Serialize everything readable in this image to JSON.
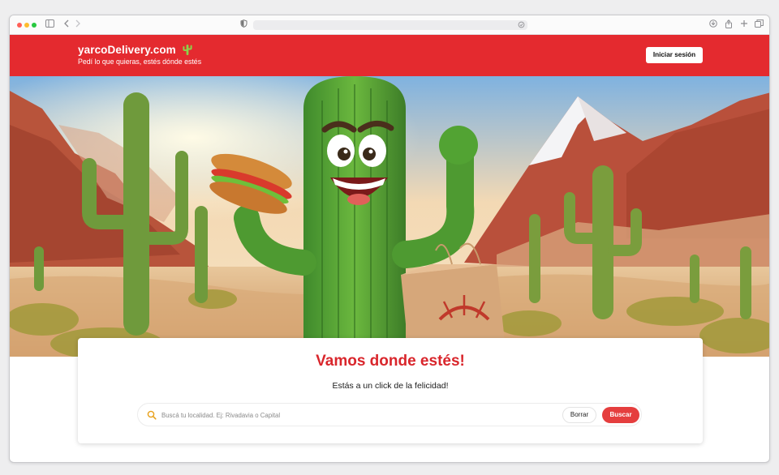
{
  "browser": {
    "icons": {
      "traffic_lights": [
        "close",
        "minimize",
        "zoom"
      ],
      "left": [
        "sidebar-icon",
        "back-icon",
        "forward-icon"
      ],
      "address": [
        "shield-icon",
        "reader-icon"
      ],
      "right": [
        "download-icon",
        "share-icon",
        "new-tab-icon",
        "tabs-overview-icon"
      ]
    }
  },
  "header": {
    "brand": "yarcoDelivery.com",
    "tagline": "Pedí lo que quieras, estés dónde estés",
    "login_label": "Iniciar sesión",
    "color": "#e42a2f"
  },
  "hero": {
    "image": "cactus-mascot-desert-illustration"
  },
  "search_card": {
    "title": "Vamos donde estés!",
    "subtitle": "Estás a un click de la felicidad!",
    "placeholder": "Buscá tu localidad. Ej: Rivadavia o Capital",
    "clear_label": "Borrar",
    "search_label": "Buscar",
    "accent": "#d9262c"
  }
}
